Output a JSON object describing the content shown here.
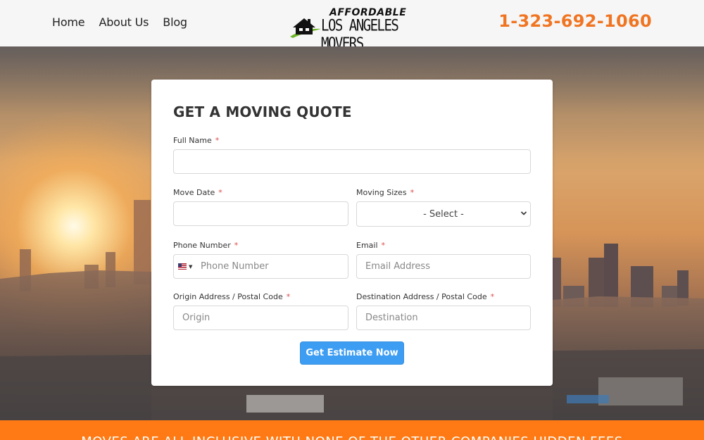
{
  "header": {
    "nav": [
      "Home",
      "About Us",
      "Blog"
    ],
    "logo": {
      "line1": "AFFORDABLE",
      "line2": "LOS ANGELES MOVERS",
      "icon": "house-icon"
    },
    "phone": "1-323-692-1060",
    "phone_color": "#f07522"
  },
  "form": {
    "title": "GET A MOVING QUOTE",
    "required_mark": "*",
    "fields": {
      "full_name": {
        "label": "Full Name",
        "value": "",
        "placeholder": ""
      },
      "move_date": {
        "label": "Move Date",
        "value": "",
        "placeholder": ""
      },
      "moving_sizes": {
        "label": "Moving Sizes",
        "selected": "- Select -"
      },
      "phone": {
        "label": "Phone Number",
        "placeholder": "Phone Number",
        "country_flag": "us-flag-icon"
      },
      "email": {
        "label": "Email",
        "placeholder": "Email Address"
      },
      "origin": {
        "label": "Origin Address / Postal Code",
        "placeholder": "Origin"
      },
      "destination": {
        "label": "Destination Address / Postal Code",
        "placeholder": "Destination"
      }
    },
    "submit_label": "Get Estimate Now",
    "button_color": "#3d9df3"
  },
  "banner": {
    "text": "MOVES ARE ALL-INCLUSIVE WITH NONE OF THE OTHER COMPANIES HIDDEN FEES",
    "color": "#ff7a14"
  }
}
